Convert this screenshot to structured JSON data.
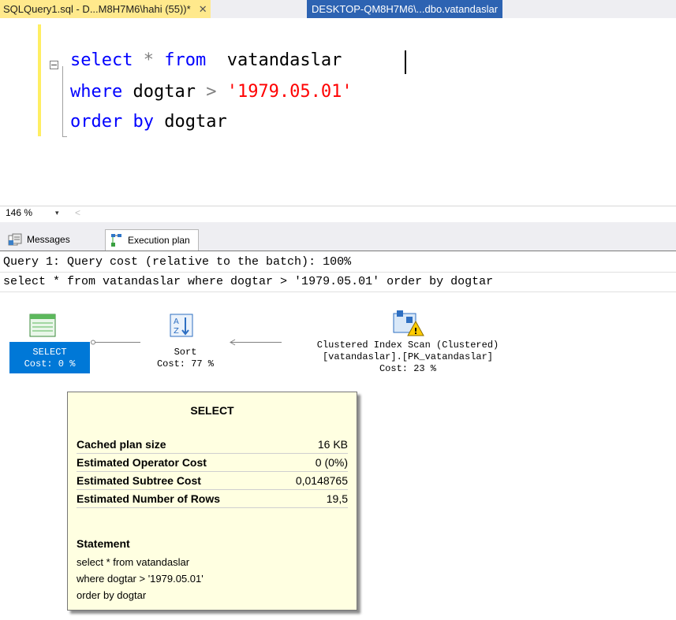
{
  "tabs": {
    "active": "SQLQuery1.sql - D...M8H7M6\\hahi (55))*",
    "close_glyph": "✕",
    "inactive": "DESKTOP-QM8H7M6\\...dbo.vatandaslar"
  },
  "editor": {
    "line1": {
      "kw1": "select",
      "op": " * ",
      "kw2": "from",
      "rest": "  vatandaslar"
    },
    "line2": {
      "kw": "where",
      "rest": " dogtar ",
      "op": ">",
      "str": " '1979.05.01'"
    },
    "line3": {
      "kw": "order by",
      "rest": " dogtar"
    }
  },
  "zoom": {
    "value": "146 %",
    "arrow": "▾",
    "scroll": "<"
  },
  "results_tabs": {
    "messages": "Messages",
    "execution_plan": "Execution plan"
  },
  "plan": {
    "query_line": "Query 1: Query cost (relative to the batch): 100%",
    "query_text": "select * from vatandaslar where dogtar > '1979.05.01' order by dogtar",
    "nodes": {
      "select": {
        "name": "SELECT",
        "cost": "Cost: 0 %"
      },
      "sort": {
        "name": "Sort",
        "cost": "Cost: 77 %"
      },
      "scan": {
        "name": "Clustered Index Scan (Clustered)",
        "object": "[vatandaslar].[PK_vatandaslar]",
        "cost": "Cost: 23 %"
      }
    }
  },
  "tooltip": {
    "title": "SELECT",
    "rows": [
      {
        "label": "Cached plan size",
        "value": "16 KB"
      },
      {
        "label": "Estimated Operator Cost",
        "value": "0 (0%)"
      },
      {
        "label": "Estimated Subtree Cost",
        "value": "0,0148765"
      },
      {
        "label": "Estimated Number of Rows",
        "value": "19,5"
      }
    ],
    "statement_title": "Statement",
    "statement_lines": [
      "select * from  vatandaslar",
      "where dogtar > '1979.05.01'",
      "order by dogtar"
    ]
  },
  "colors": {
    "active_tab": "#ffe98c",
    "inactive_tab": "#2d63b2",
    "keyword": "#0000ff",
    "string": "#ff0000",
    "selected_node": "#0078d7",
    "tooltip_bg": "#ffffe1"
  }
}
